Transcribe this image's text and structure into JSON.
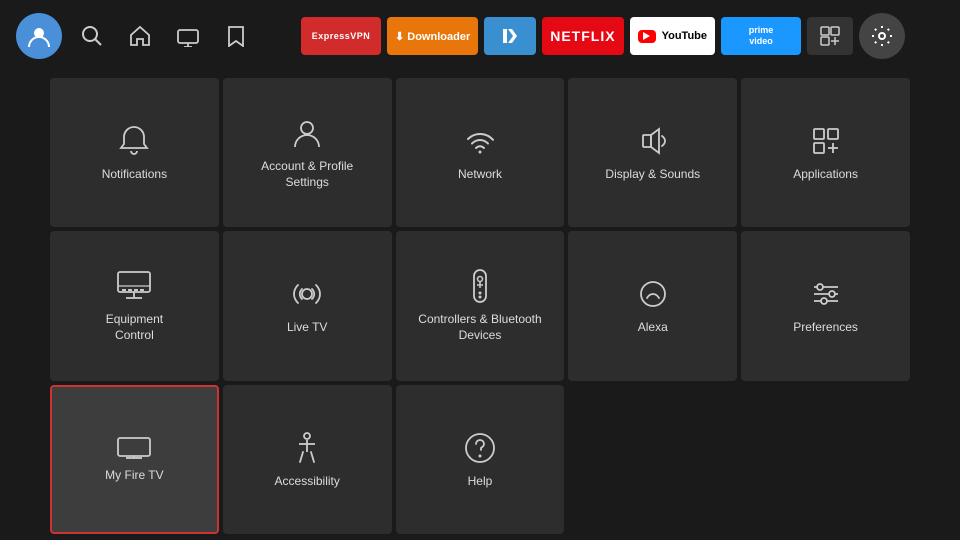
{
  "topbar": {
    "nav_icons": [
      "search",
      "home",
      "tv",
      "bookmark"
    ],
    "apps": [
      {
        "label": "ExpressVPN",
        "key": "expressvpn"
      },
      {
        "label": "Downloader",
        "key": "downloader"
      },
      {
        "label": "↑",
        "key": "tubi"
      },
      {
        "label": "NETFLIX",
        "key": "netflix"
      },
      {
        "label": "YouTube",
        "key": "youtube"
      },
      {
        "label": "prime video",
        "key": "prime"
      },
      {
        "label": "⊞",
        "key": "grid"
      },
      {
        "label": "⚙",
        "key": "settings"
      }
    ]
  },
  "grid": {
    "items": [
      {
        "id": "notifications",
        "label": "Notifications",
        "icon": "bell"
      },
      {
        "id": "account",
        "label": "Account & Profile\nSettings",
        "icon": "person"
      },
      {
        "id": "network",
        "label": "Network",
        "icon": "wifi"
      },
      {
        "id": "display",
        "label": "Display & Sounds",
        "icon": "speaker"
      },
      {
        "id": "applications",
        "label": "Applications",
        "icon": "apps"
      },
      {
        "id": "equipment",
        "label": "Equipment\nControl",
        "icon": "monitor"
      },
      {
        "id": "livetv",
        "label": "Live TV",
        "icon": "antenna"
      },
      {
        "id": "controllers",
        "label": "Controllers & Bluetooth\nDevices",
        "icon": "remote"
      },
      {
        "id": "alexa",
        "label": "Alexa",
        "icon": "alexa"
      },
      {
        "id": "preferences",
        "label": "Preferences",
        "icon": "sliders"
      },
      {
        "id": "myfiretv",
        "label": "My Fire TV",
        "icon": "firetv",
        "selected": true
      },
      {
        "id": "accessibility",
        "label": "Accessibility",
        "icon": "accessibility"
      },
      {
        "id": "help",
        "label": "Help",
        "icon": "help"
      }
    ]
  }
}
